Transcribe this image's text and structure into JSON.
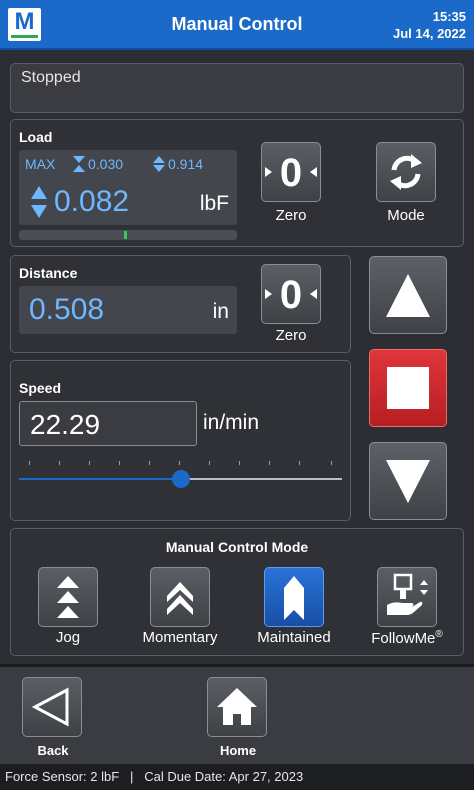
{
  "header": {
    "title": "Manual Control",
    "time": "15:35",
    "date": "Jul 14, 2022",
    "logo_letter": "M"
  },
  "status": {
    "text": "Stopped"
  },
  "load": {
    "label": "Load",
    "max_label": "MAX",
    "max_low": "0.030",
    "max_high": "0.914",
    "value": "0.082",
    "unit": "lbF",
    "zero_label": "Zero",
    "mode_label": "Mode"
  },
  "distance": {
    "label": "Distance",
    "value": "0.508",
    "unit": "in",
    "zero_label": "Zero"
  },
  "speed": {
    "label": "Speed",
    "value": "22.29",
    "unit": "in/min",
    "slider_level": 0.5
  },
  "mode": {
    "title": "Manual Control Mode",
    "options": [
      {
        "label": "Jog",
        "icon": "jog-icon",
        "selected": false
      },
      {
        "label": "Momentary",
        "icon": "momentary-icon",
        "selected": false
      },
      {
        "label": "Maintained",
        "icon": "maintained-icon",
        "selected": true
      },
      {
        "label": "FollowMe",
        "icon": "followme-icon",
        "selected": false,
        "suffix": "®"
      }
    ]
  },
  "nav": {
    "back_label": "Back",
    "home_label": "Home"
  },
  "bottom": {
    "text": "Force Sensor: 2 lbF   |   Cal Due Date: Apr 27, 2023"
  },
  "colors": {
    "accent": "#1b6ac9",
    "value_blue": "#6fb7ff",
    "stop_red": "#d0282c",
    "selected": "#1e5fbf"
  }
}
